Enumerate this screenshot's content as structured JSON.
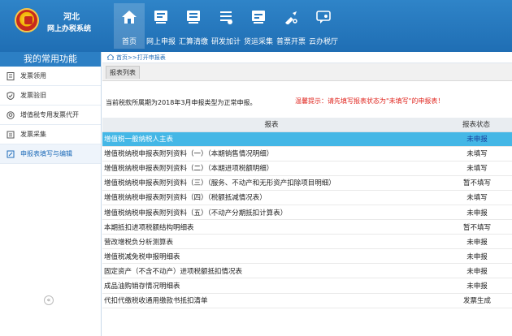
{
  "header": {
    "logo_line1": "河北",
    "logo_line2": "网上办税系统",
    "nav": [
      {
        "label": "首页",
        "icon": "home-icon"
      },
      {
        "label": "网上申报",
        "icon": "declare-icon"
      },
      {
        "label": "汇算清缴",
        "icon": "settlement-icon"
      },
      {
        "label": "研发加计",
        "icon": "rd-deduction-icon"
      },
      {
        "label": "货运采集",
        "icon": "freight-icon"
      },
      {
        "label": "普票开票",
        "icon": "invoice-issue-icon"
      },
      {
        "label": "云办税厅",
        "icon": "cloud-hall-icon"
      }
    ]
  },
  "sidebar": {
    "title": "我的常用功能",
    "items": [
      {
        "label": "发票领用",
        "icon": "document-icon"
      },
      {
        "label": "发票验旧",
        "icon": "shield-check-icon"
      },
      {
        "label": "增值税专用发票代开",
        "icon": "search-circle-icon"
      },
      {
        "label": "发票采集",
        "icon": "collect-icon"
      },
      {
        "label": "申报表填写与编辑",
        "icon": "edit-form-icon"
      }
    ],
    "collapse": "«"
  },
  "main": {
    "breadcrumb": "首页>>打开申报表",
    "tab_label": "报表列表",
    "notice_text": "当前税款所属期为2018年3月申报类型为正常申报。",
    "notice_tip": "温馨提示：请先填写报表状态为\"未填写\"的申报表！",
    "table": {
      "col_report": "报表",
      "col_status": "报表状态",
      "rows": [
        {
          "name": "增值税一般纳税人主表",
          "status": "未申报",
          "kind": "unfiled",
          "selected": true
        },
        {
          "name": "增值税纳税申报表附列资料（一）（本期销售情况明细）",
          "status": "未填写",
          "kind": "unfilled"
        },
        {
          "name": "增值税纳税申报表附列资料（二）（本期进项税额明细）",
          "status": "未填写",
          "kind": "unfilled"
        },
        {
          "name": "增值税纳税申报表附列资料（三）（服务、不动产和无形资产扣除项目明细）",
          "status": "暂不填写",
          "kind": "disabled"
        },
        {
          "name": "增值税纳税申报表附列资料（四）（税额抵减情况表）",
          "status": "未填写",
          "kind": "unfilled"
        },
        {
          "name": "增值税纳税申报表附列资料（五）（不动产分期抵扣计算表）",
          "status": "未申报",
          "kind": "unfiled"
        },
        {
          "name": "本期抵扣进项税额结构明细表",
          "status": "暂不填写",
          "kind": "disabled"
        },
        {
          "name": "营改增税负分析测算表",
          "status": "未申报",
          "kind": "unfiled"
        },
        {
          "name": "增值税减免税申报明细表",
          "status": "未申报",
          "kind": "unfiled"
        },
        {
          "name": "固定资产（不含不动产）进项税额抵扣情况表",
          "status": "未申报",
          "kind": "unfiled"
        },
        {
          "name": "成品油购销存情况明细表",
          "status": "未申报",
          "kind": "unfiled"
        },
        {
          "name": "代扣代缴税收通用缴款书抵扣清单",
          "status": "发票生成",
          "kind": "disabled"
        }
      ]
    }
  },
  "colors": {
    "header_bg": "#2578be",
    "selected_row": "#44b7e6",
    "unfiled": "#1a3ec8",
    "unfilled": "#e0261f",
    "disabled": "#b8b8b8"
  }
}
